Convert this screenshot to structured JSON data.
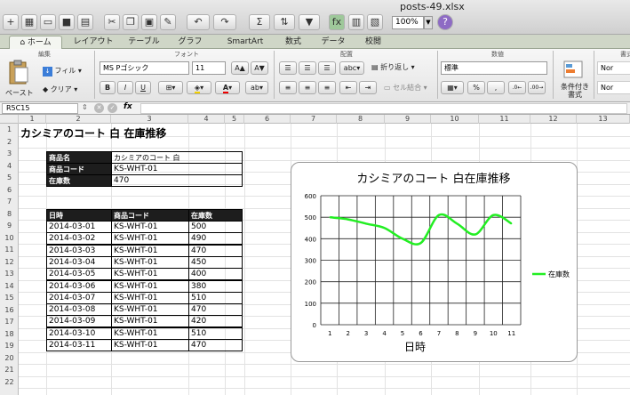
{
  "window": {
    "title": "posts-49.xlsx"
  },
  "toolbar": {
    "icons": [
      "new-sheet-icon",
      "grid-icon",
      "open-icon",
      "save-icon",
      "print-icon",
      "cut-icon",
      "copy-icon",
      "paste-icon",
      "format-painter-icon",
      "undo-icon",
      "redo-icon",
      "autosum-icon",
      "sort-icon",
      "filter-icon",
      "function-icon",
      "gallery-icon",
      "toolbox-icon",
      "media-icon"
    ],
    "zoom": "100%"
  },
  "ribbon_tabs": [
    "ホーム",
    "レイアウト",
    "テーブル",
    "グラフ",
    "SmartArt",
    "数式",
    "データ",
    "校閲"
  ],
  "ribbon": {
    "groups": {
      "edit": "編集",
      "font": "フォント",
      "alignment": "配置",
      "number": "数値",
      "format": "書式"
    },
    "fill_label": "フィル",
    "clear_label": "クリア",
    "paste_label": "ペースト",
    "font_name": "MS Pゴシック",
    "font_size": "11",
    "bold": "B",
    "italic": "I",
    "underline": "U",
    "wrap_label": "折り返し",
    "merge_label": "セル結合",
    "number_format": "標準",
    "percent_label": "%",
    "conditional_label": "条件付き書式",
    "abc_label": "abc",
    "style_samples": [
      "Nor",
      "Nor"
    ]
  },
  "formula_bar": {
    "name_box": "R5C15",
    "fx_label": "fx",
    "value": ""
  },
  "sheet": {
    "column_headers": [
      "1",
      "2",
      "3",
      "4",
      "5",
      "6",
      "7",
      "8",
      "9",
      "10",
      "11",
      "12",
      "13"
    ],
    "row_headers": [
      "1",
      "2",
      "3",
      "4",
      "5",
      "6",
      "7",
      "8",
      "9",
      "10",
      "11",
      "12",
      "13",
      "14",
      "15",
      "16",
      "17",
      "18",
      "19",
      "20",
      "21",
      "22"
    ],
    "title": "カシミアのコート 白 在庫推移",
    "info_table": [
      {
        "label": "商品名",
        "value": "カシミアのコート 白"
      },
      {
        "label": "商品コード",
        "value": "KS-WHT-01"
      },
      {
        "label": "在庫数",
        "value": "470"
      }
    ],
    "data_headers": [
      "日時",
      "商品コード",
      "在庫数"
    ],
    "data_rows": [
      [
        "2014-03-01",
        "KS-WHT-01",
        "500"
      ],
      [
        "2014-03-02",
        "KS-WHT-01",
        "490"
      ],
      [
        "2014-03-03",
        "KS-WHT-01",
        "470"
      ],
      [
        "2014-03-04",
        "KS-WHT-01",
        "450"
      ],
      [
        "2014-03-05",
        "KS-WHT-01",
        "400"
      ],
      [
        "2014-03-06",
        "KS-WHT-01",
        "380"
      ],
      [
        "2014-03-07",
        "KS-WHT-01",
        "510"
      ],
      [
        "2014-03-08",
        "KS-WHT-01",
        "470"
      ],
      [
        "2014-03-09",
        "KS-WHT-01",
        "420"
      ],
      [
        "2014-03-10",
        "KS-WHT-01",
        "510"
      ],
      [
        "2014-03-11",
        "KS-WHT-01",
        "470"
      ]
    ]
  },
  "chart_data": {
    "type": "line",
    "title": "カシミアのコート 白在庫推移",
    "xlabel": "日時",
    "ylabel": "",
    "categories": [
      "1",
      "2",
      "3",
      "4",
      "5",
      "6",
      "7",
      "8",
      "9",
      "10",
      "11"
    ],
    "series": [
      {
        "name": "在庫数",
        "values": [
          500,
          490,
          470,
          450,
          400,
          380,
          510,
          470,
          420,
          510,
          470
        ],
        "color": "#22ee22"
      }
    ],
    "ylim": [
      0,
      600
    ],
    "yticks": [
      "0",
      "100",
      "200",
      "300",
      "400",
      "500",
      "600"
    ],
    "grid": true,
    "legend": "right"
  },
  "colors": {
    "ribbon_tab_bar": "#cfd6c7",
    "header_fill": "#1d1d1d",
    "series_line": "#22ee22"
  }
}
